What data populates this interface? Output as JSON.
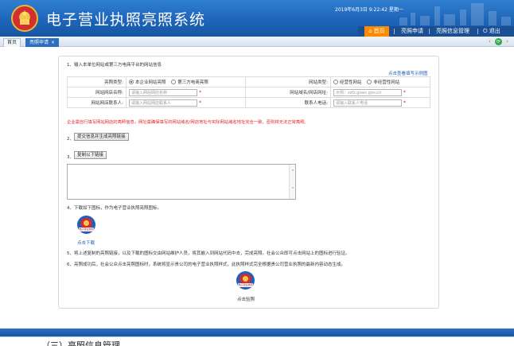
{
  "app": {
    "title": "电子营业执照亮照系统",
    "datetime": "2019年6月3日 9:22:42 星期一"
  },
  "nav": {
    "items": [
      {
        "label": "⌂ 首页",
        "active": true
      },
      {
        "label": "亮照申请",
        "active": false
      },
      {
        "label": "亮照信息管理",
        "active": false
      },
      {
        "label": "⏻ 退出",
        "active": false
      }
    ]
  },
  "tabs": [
    {
      "label": "首页",
      "active": false
    },
    {
      "label": "亮照申请",
      "active": true,
      "close": "×"
    }
  ],
  "tab_nav": {
    "prev": "‹",
    "refresh": "⟳",
    "next": "›"
  },
  "steps": {
    "s1": "1、输入本单位网站或第三方电商平台的网站信息",
    "s2": "2、",
    "s3": "3、",
    "s4": "4、下载如下图标，作为电子营业执照亮照图标。",
    "s5": "5、将上述复制的亮照链接，以及下载的图标交由网站维护人员，将其嵌入到网站代码中去，完成亮照。社会公众即可点击网站上的图标进行验证。",
    "s6": "6、亮照成功后，社会公众点击亮照图标时，系统将显示贵公司的电子营业执照样式，此执照样式完全根据贵公司营业执照的最新内容动态生成。"
  },
  "example_link": "点击查看填写示例图",
  "form": {
    "type_label": "亮照类型:",
    "type_options": [
      {
        "label": "本企业网站亮照",
        "checked": true
      },
      {
        "label": "第三方电商亮照",
        "checked": false
      }
    ],
    "site_type_label": "网站类型:",
    "site_type_options": [
      {
        "label": "经营性网站",
        "checked": false
      },
      {
        "label": "非经营性网站",
        "checked": false
      }
    ],
    "name_label": "网站网店名称:",
    "name_placeholder": "请输入网站网店名称",
    "domain_label": "网站域名/网店网址:",
    "domain_placeholder": "示例：zzfz.gsaic.gov.cn",
    "contact_label": "网站网店联系人:",
    "contact_placeholder": "请输入网站网店联系人",
    "phone_label": "联系人电话:",
    "phone_placeholder": "请输入联系人电话",
    "required_mark": "*"
  },
  "warning": "企业需自行填写网站网店的亮照信息，网址需确保填写的网站域名/网店地址与实际网站域名地址完全一致，否则将无法正常亮照。",
  "buttons": {
    "submit": "提交信息并生成亮照链接",
    "copy": "复制以下链接"
  },
  "badge_text": "电子营业执照",
  "download_link": "点击下载",
  "verify_link": "点击验照",
  "section_heading": "（三）亮照信息管理"
}
